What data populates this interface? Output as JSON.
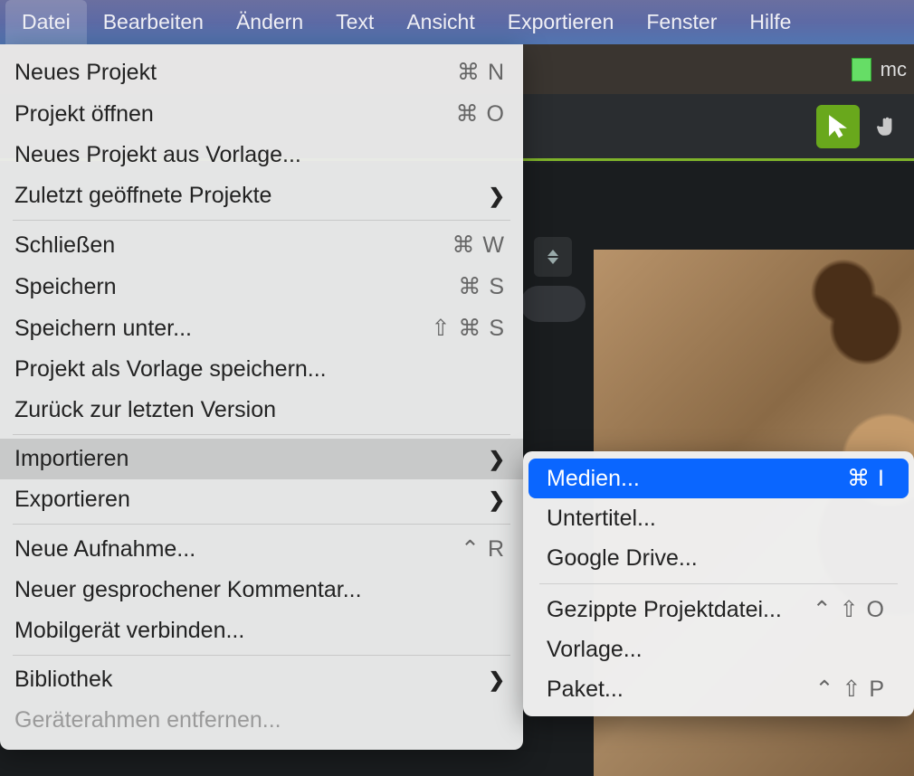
{
  "menubar": {
    "items": [
      "Datei",
      "Bearbeiten",
      "Ändern",
      "Text",
      "Ansicht",
      "Exportieren",
      "Fenster",
      "Hilfe"
    ],
    "active_index": 0
  },
  "document": {
    "name": "mc"
  },
  "file_menu": {
    "groups": [
      [
        {
          "label": "Neues Projekt",
          "shortcut": "⌘ N"
        },
        {
          "label": "Projekt öffnen",
          "shortcut": "⌘ O"
        },
        {
          "label": "Neues Projekt aus Vorlage..."
        },
        {
          "label": "Zuletzt geöffnete Projekte",
          "submenu": true
        }
      ],
      [
        {
          "label": "Schließen",
          "shortcut": "⌘ W"
        },
        {
          "label": "Speichern",
          "shortcut": "⌘ S"
        },
        {
          "label": "Speichern unter...",
          "shortcut": "⇧ ⌘ S"
        },
        {
          "label": "Projekt als Vorlage speichern..."
        },
        {
          "label": "Zurück zur letzten Version"
        }
      ],
      [
        {
          "label": "Importieren",
          "submenu": true,
          "hover": true
        },
        {
          "label": "Exportieren",
          "submenu": true
        }
      ],
      [
        {
          "label": "Neue Aufnahme...",
          "shortcut": "⌃ R"
        },
        {
          "label": "Neuer gesprochener Kommentar..."
        },
        {
          "label": "Mobilgerät verbinden..."
        }
      ],
      [
        {
          "label": "Bibliothek",
          "submenu": true
        },
        {
          "label": "Geräterahmen entfernen...",
          "disabled": true
        }
      ]
    ]
  },
  "import_submenu": {
    "groups": [
      [
        {
          "label": "Medien...",
          "shortcut": "⌘ I",
          "highlight": true
        },
        {
          "label": "Untertitel..."
        },
        {
          "label": "Google Drive..."
        }
      ],
      [
        {
          "label": "Gezippte Projektdatei...",
          "shortcut": "⌃ ⇧ O"
        },
        {
          "label": "Vorlage..."
        },
        {
          "label": "Paket...",
          "shortcut": "⌃ ⇧ P"
        }
      ]
    ]
  }
}
